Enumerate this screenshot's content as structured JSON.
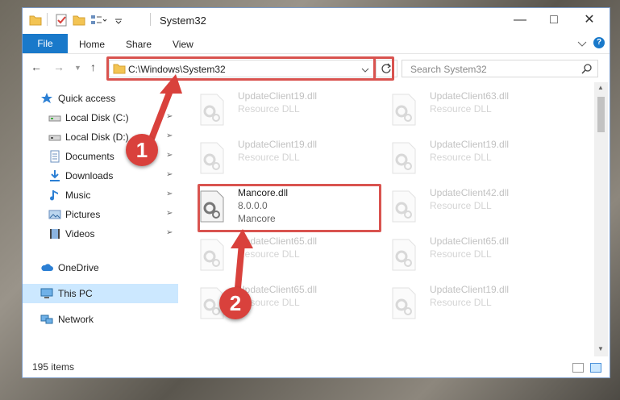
{
  "window": {
    "title": "System32",
    "ribbon_tabs": [
      "File",
      "Home",
      "Share",
      "View"
    ]
  },
  "nav": {
    "address": "C:\\Windows\\System32",
    "search_placeholder": "Search System32"
  },
  "sidebar": {
    "items": [
      {
        "label": "Quick access",
        "icon": "star-icon"
      },
      {
        "label": "Local Disk (C:)",
        "icon": "drive-icon",
        "pinned": true
      },
      {
        "label": "Local Disk (D:)",
        "icon": "drive-icon",
        "pinned": true
      },
      {
        "label": "Documents",
        "icon": "documents-icon",
        "pinned": true
      },
      {
        "label": "Downloads",
        "icon": "download-icon",
        "pinned": true
      },
      {
        "label": "Music",
        "icon": "music-icon",
        "pinned": true
      },
      {
        "label": "Pictures",
        "icon": "pictures-icon",
        "pinned": true
      },
      {
        "label": "Videos",
        "icon": "videos-icon",
        "pinned": true
      },
      {
        "label": "OneDrive",
        "icon": "cloud-icon"
      },
      {
        "label": "This PC",
        "icon": "computer-icon",
        "selected": true
      },
      {
        "label": "Network",
        "icon": "network-icon"
      }
    ]
  },
  "files": [
    {
      "name": "UpdateClient19.dll",
      "desc": "Resource DLL",
      "faded": true
    },
    {
      "name": "UpdateClient63.dll",
      "desc": "Resource DLL",
      "faded": true
    },
    {
      "name": "UpdateClient19.dll",
      "desc": "Resource DLL",
      "faded": true
    },
    {
      "name": "UpdateClient19.dll",
      "desc": "Resource DLL",
      "faded": true
    },
    {
      "name": "Mancore.dll",
      "version": "8.0.0.0",
      "desc": "Mancore",
      "faded": false
    },
    {
      "name": "UpdateClient42.dll",
      "desc": "Resource DLL",
      "faded": true
    },
    {
      "name": "UpdateClient65.dll",
      "desc": "Resource DLL",
      "faded": true
    },
    {
      "name": "UpdateClient65.dll",
      "desc": "Resource DLL",
      "faded": true
    },
    {
      "name": "UpdateClient65.dll",
      "desc": "Resource DLL",
      "faded": true
    },
    {
      "name": "UpdateClient19.dll",
      "desc": "Resource DLL",
      "faded": true
    }
  ],
  "status": {
    "count": "195 items"
  },
  "callouts": [
    "1",
    "2"
  ],
  "colors": {
    "accent": "#1979ca",
    "highlight": "#d9534f",
    "selected": "#cce8ff"
  }
}
